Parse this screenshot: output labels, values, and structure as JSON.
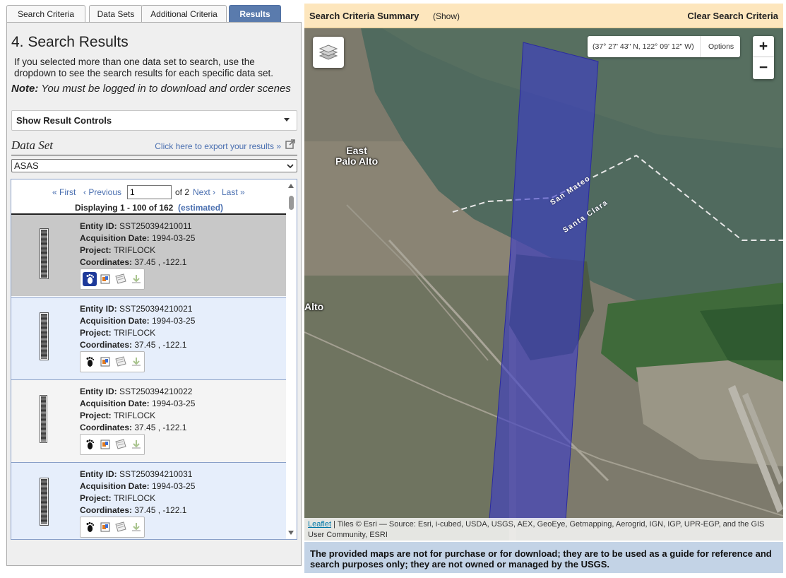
{
  "tabs": [
    {
      "label": "Search Criteria"
    },
    {
      "label": "Data Sets"
    },
    {
      "label": "Additional Criteria"
    },
    {
      "label": "Results"
    }
  ],
  "panel": {
    "title": "4. Search Results",
    "description": "If you selected more than one data set to search, use the dropdown to see the search results for each specific data set.",
    "note_label": "Note:",
    "note_text": " You must be logged in to download and order scenes",
    "result_controls_label": "Show Result Controls",
    "dataset_label": "Data Set",
    "export_link": "Click here to export your results »",
    "dataset_selected": "ASAS"
  },
  "pager": {
    "first": "« First",
    "previous": "‹ Previous",
    "current_page": "1",
    "of_pages": "of 2",
    "next": "Next ›",
    "last": "Last »",
    "displaying": "Displaying 1 - 100 of 162",
    "estimated": "(estimated)"
  },
  "field_labels": {
    "entity": "Entity ID:",
    "date": "Acquisition Date:",
    "project": "Project:",
    "coords": "Coordinates:"
  },
  "results": [
    {
      "entity_id": "SST250394210011",
      "date": "1994-03-25",
      "project": "TRIFLOCK",
      "coordinates": "37.45 , -122.1"
    },
    {
      "entity_id": "SST250394210021",
      "date": "1994-03-25",
      "project": "TRIFLOCK",
      "coordinates": "37.45 , -122.1"
    },
    {
      "entity_id": "SST250394210022",
      "date": "1994-03-25",
      "project": "TRIFLOCK",
      "coordinates": "37.45 , -122.1"
    },
    {
      "entity_id": "SST250394210031",
      "date": "1994-03-25",
      "project": "TRIFLOCK",
      "coordinates": "37.45 , -122.1"
    }
  ],
  "summary": {
    "title": "Search Criteria Summary",
    "show": "(Show)",
    "clear": "Clear Search Criteria"
  },
  "map": {
    "coordinates": "(37° 27' 43\" N, 122° 09' 12\" W)",
    "options": "Options",
    "zoom_in": "+",
    "zoom_out": "−",
    "labels": {
      "east_palo_alto_1": "East",
      "east_palo_alto_2": "Palo Alto",
      "alto": "Alto",
      "san_mateo": "San Mateo",
      "santa_clara": "Santa Clara"
    },
    "attribution_link": "Leaflet",
    "attribution_text": " | Tiles © Esri — Source: Esri, i-cubed, USDA, USGS, AEX, GeoEye, Getmapping, Aerogrid, IGN, IGP, UPR-EGP, and the GIS User Community, ESRI",
    "footprint_color": "#3c3cc8",
    "water_color": "#506a5e"
  },
  "disclaimer": "The provided maps are not for purchase or for download; they are to be used as a guide for reference and search purposes only; they are not owned or managed by the USGS."
}
